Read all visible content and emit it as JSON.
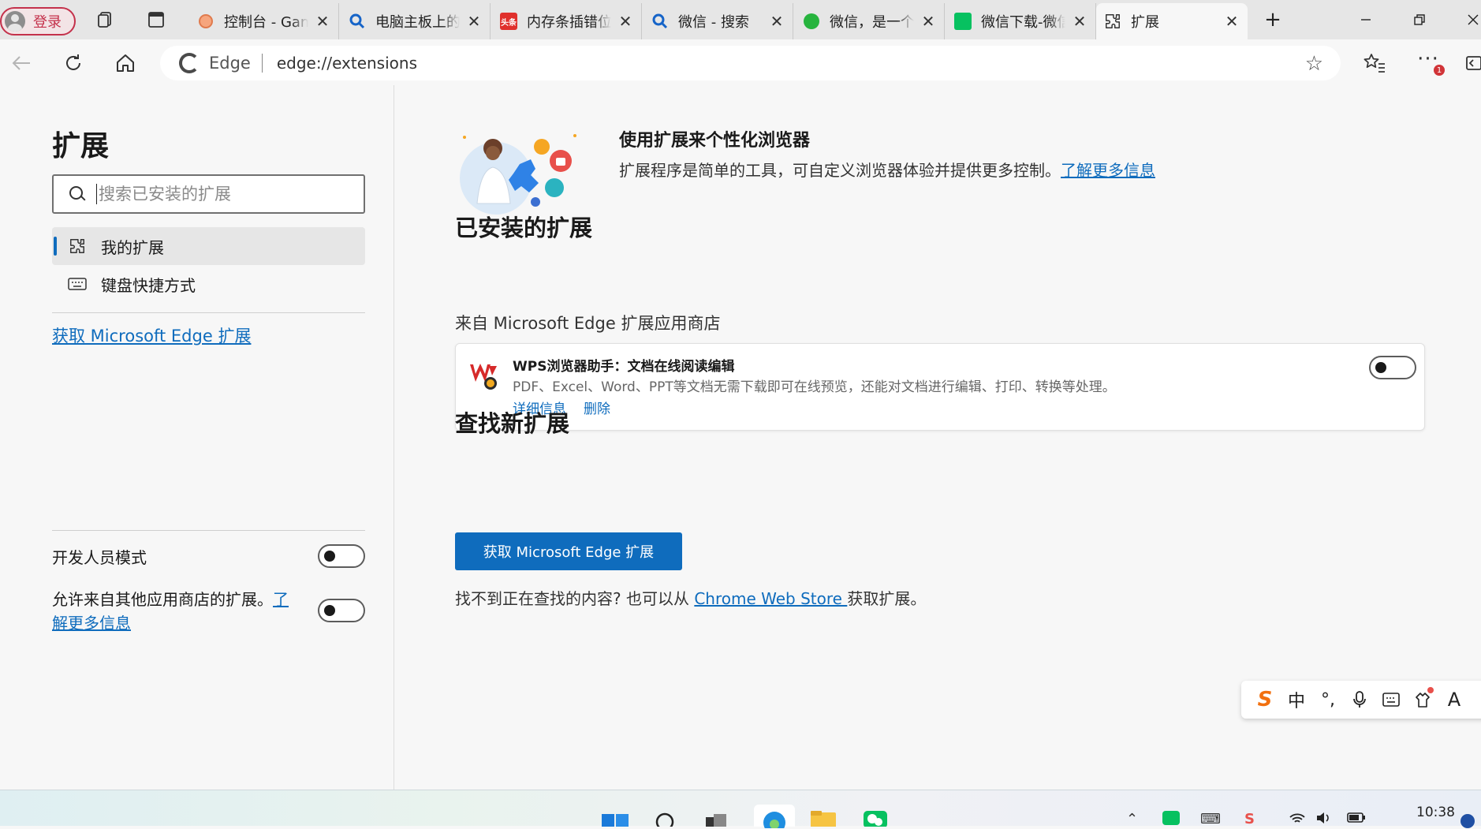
{
  "browser": {
    "profile_label": "登录",
    "tabs": [
      {
        "title": "控制台 - GameGuardian",
        "icon": "peach-favicon"
      },
      {
        "title": "电脑主板上的内存条插槽",
        "icon": "search-icon"
      },
      {
        "title": "内存条插错位置会怎样",
        "icon": "toutiao-favicon"
      },
      {
        "title": "微信 - 搜索",
        "icon": "search-icon"
      },
      {
        "title": "微信，是一个生活方式",
        "icon": "wechat-favicon"
      },
      {
        "title": "微信下载-微信官方",
        "icon": "wechat-favicon"
      },
      {
        "title": "扩展",
        "icon": "puzzle-icon"
      }
    ],
    "new_tab": "+",
    "menu_badge": "1"
  },
  "address_bar": {
    "site_label": "Edge",
    "url": "edge://extensions"
  },
  "sidebar": {
    "title": "扩展",
    "search_placeholder": "搜索已安装的扩展",
    "items": [
      {
        "label": "我的扩展",
        "icon": "puzzle-icon",
        "selected": true
      },
      {
        "label": "键盘快捷方式",
        "icon": "keyboard-icon",
        "selected": false
      }
    ],
    "get_link": "获取 Microsoft Edge 扩展",
    "dev_mode_label": "开发人员模式",
    "allow_other_stores_label": "允许来自其他应用商店的扩展。",
    "allow_other_stores_link_1": "了",
    "allow_other_stores_link_2": "解更多信息"
  },
  "main": {
    "hero_title": "使用扩展来个性化浏览器",
    "hero_desc": "扩展程序是简单的工具，可自定义浏览器体验并提供更多控制。",
    "hero_link": "了解更多信息",
    "installed_title": "已安装的扩展",
    "source_label": "来自 Microsoft Edge 扩展应用商店",
    "extension": {
      "name": "WPS浏览器助手：文档在线阅读编辑",
      "description": "PDF、Excel、Word、PPT等文档无需下载即可在线预览，还能对文档进行编辑、打印、转换等处理。",
      "details_label": "详细信息",
      "remove_label": "删除",
      "enabled": false
    },
    "find_title": "查找新扩展",
    "get_button": "获取 Microsoft Edge 扩展",
    "find_text_before": "找不到正在查找的内容? 也可以从 ",
    "find_link": "Chrome Web Store ",
    "find_text_after": "获取扩展。"
  },
  "ime": {
    "logo": "S",
    "mode": "中",
    "punct": "°,"
  },
  "taskbar": {
    "time": "10:38"
  },
  "colors": {
    "accent": "#0f6cbd",
    "profile_red": "#c4314b"
  }
}
